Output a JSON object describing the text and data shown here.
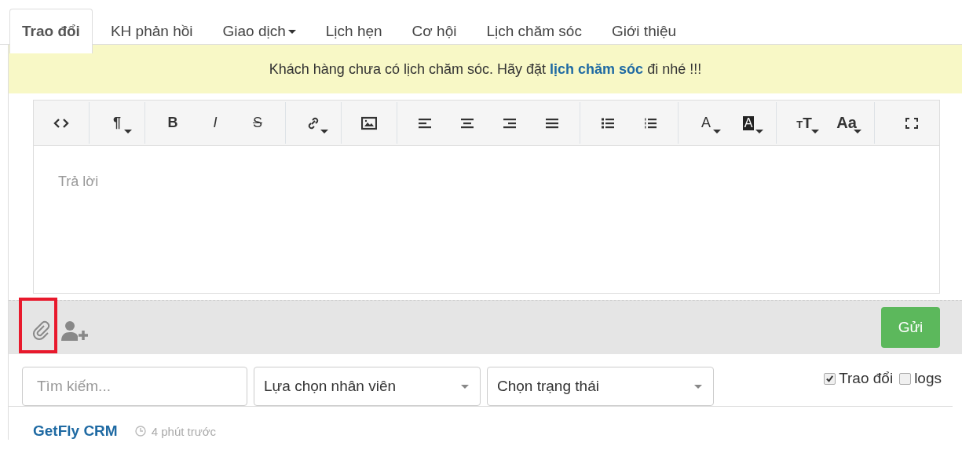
{
  "tabs": [
    {
      "label": "Trao đổi",
      "selected": true,
      "dropdown": false
    },
    {
      "label": "KH phản hồi",
      "selected": false,
      "dropdown": false
    },
    {
      "label": "Giao dịch",
      "selected": false,
      "dropdown": true
    },
    {
      "label": "Lịch hẹn",
      "selected": false,
      "dropdown": false
    },
    {
      "label": "Cơ hội",
      "selected": false,
      "dropdown": false
    },
    {
      "label": "Lịch chăm sóc",
      "selected": false,
      "dropdown": false
    },
    {
      "label": "Giới thiệu",
      "selected": false,
      "dropdown": false
    }
  ],
  "notice": {
    "before": "Khách hàng chưa có lịch chăm sóc. Hãy đặt",
    "link": "lịch chăm sóc",
    "after": "đi nhé !!!"
  },
  "editor": {
    "toolbar": [
      [
        {
          "kind": "code"
        }
      ],
      [
        {
          "kind": "paragraph",
          "label": "¶",
          "dropdown": true
        }
      ],
      [
        {
          "kind": "bold",
          "label": "B"
        },
        {
          "kind": "italic",
          "label": "I"
        },
        {
          "kind": "strike",
          "label": "S"
        }
      ],
      [
        {
          "kind": "link",
          "dropdown": true
        }
      ],
      [
        {
          "kind": "image"
        }
      ],
      [
        {
          "kind": "align-left"
        },
        {
          "kind": "align-center"
        },
        {
          "kind": "align-right"
        },
        {
          "kind": "justify"
        }
      ],
      [
        {
          "kind": "bullets"
        },
        {
          "kind": "numbers"
        }
      ],
      [
        {
          "kind": "fore-color",
          "label": "A",
          "dropdown": true
        },
        {
          "kind": "back-color",
          "label": "A",
          "dropdown": true
        }
      ],
      [
        {
          "kind": "font-size",
          "label": "TT",
          "dropdown": true
        },
        {
          "kind": "font-name",
          "label": "Aa",
          "dropdown": true
        }
      ],
      [
        {
          "kind": "fullscreen"
        }
      ]
    ],
    "placeholder": "Trả lời"
  },
  "footer": {
    "send_button": "Gửi"
  },
  "filters": {
    "search": {
      "placeholder": "Tìm kiếm..."
    },
    "selects": [
      {
        "value": "Lựa chọn nhân viên"
      },
      {
        "value": "Chọn trạng thái"
      }
    ],
    "checkboxes": [
      {
        "label": "Trao đổi",
        "checked": true
      },
      {
        "label": "logs",
        "checked": false
      }
    ]
  },
  "feed": [
    {
      "author": "GetFly CRM",
      "time": "4 phút trước"
    }
  ]
}
